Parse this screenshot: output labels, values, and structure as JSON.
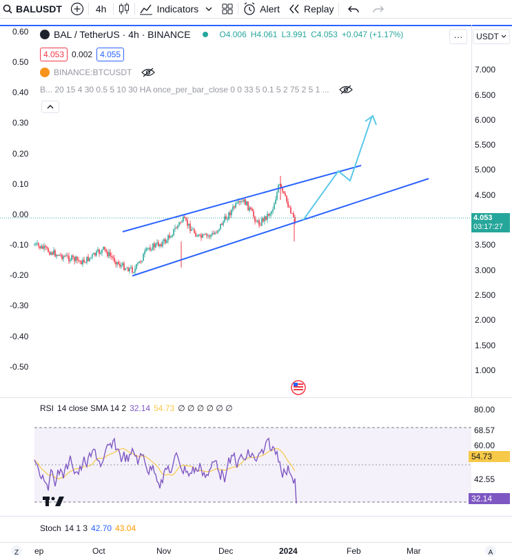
{
  "toolbar": {
    "symbol": "BALUSDT",
    "add_label": "+",
    "interval": "4h",
    "indicators_label": "Indicators",
    "alert_label": "Alert",
    "replay_label": "Replay"
  },
  "legend": {
    "title": "BAL / TetherUS · 4h · BINANCE",
    "open": "O4.006",
    "high": "H4.061",
    "low": "L3.991",
    "close": "C4.053",
    "change": "+0.047 (+1.17%)",
    "bid": "4.053",
    "spread": "0.002",
    "ask": "4.055",
    "compare_symbol": "BINANCE:BTCUSDT",
    "script_params": "B... 20 15 4 30 0.5 5 10 30 HA once_per_bar_close 0 0 33 5 0.1 5 2 75 2 5 1 ..."
  },
  "currency_select": "USDT",
  "more_label": "···",
  "left_axis": [
    "0.60",
    "0.50",
    "0.40",
    "0.30",
    "0.20",
    "0.10",
    "0.00",
    "-0.10",
    "-0.20",
    "-0.30",
    "-0.40",
    "-0.50"
  ],
  "right_axis": [
    "7.000",
    "6.500",
    "6.000",
    "5.500",
    "5.000",
    "4.500",
    "3.500",
    "3.000",
    "2.500",
    "2.000",
    "1.500",
    "1.000"
  ],
  "price_tag": {
    "price": "4.053",
    "countdown": "03:17:27"
  },
  "rsi": {
    "name": "RSI",
    "params": "14 close SMA 14 2",
    "value1": "32.14",
    "value2": "54.73",
    "extra": "∅ ∅ ∅ ∅ ∅ ∅",
    "axis": [
      "80.00",
      "68.57",
      "60.00",
      "42.55"
    ],
    "tag_ma": "54.73",
    "tag_rsi": "32.14"
  },
  "stoch": {
    "name": "Stoch",
    "params": "14 1 3",
    "k": "42.70",
    "d": "43.04"
  },
  "time_axis": {
    "labels": [
      "ep",
      "Oct",
      "Nov",
      "Dec",
      "2024",
      "Feb",
      "Mar"
    ],
    "left_btn": "Z",
    "right_btn": "A"
  },
  "colors": {
    "accent": "#2962ff",
    "up": "#26a69a",
    "down": "#f23645",
    "rsi_line": "#7e57c2",
    "rsi_ma": "#f7c948",
    "channel": "#2962ff",
    "projection": "#5ac8e8"
  },
  "icons": [
    "search-icon",
    "plus-icon",
    "candles-icon",
    "indicators-icon",
    "templates-icon",
    "alert-icon",
    "replay-icon",
    "undo-icon",
    "redo-icon",
    "eye-off-icon",
    "chevron-up-icon",
    "tradingview-logo",
    "usa-flag-icon"
  ]
}
